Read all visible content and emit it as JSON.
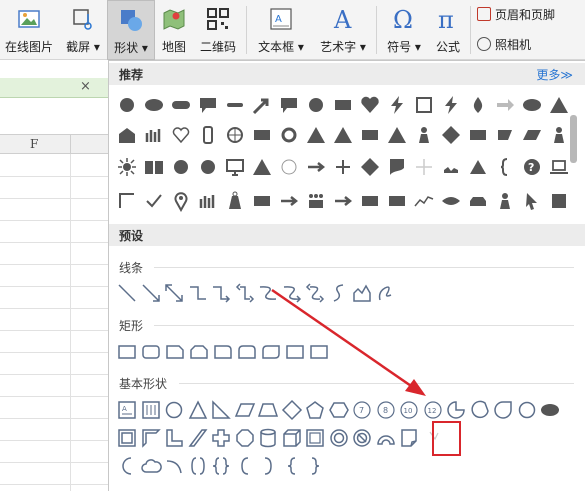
{
  "ribbon": {
    "buttons": [
      {
        "label": "在线图片"
      },
      {
        "label": "截屏 ▾"
      },
      {
        "label": "形状 ▾"
      },
      {
        "label": "地图"
      },
      {
        "label": "二维码"
      },
      {
        "label": "文本框 ▾"
      },
      {
        "label": "艺术字 ▾"
      },
      {
        "label": "符号 ▾"
      },
      {
        "label": "公式"
      }
    ],
    "header_footer": "页眉和页脚",
    "camera": "照相机"
  },
  "sheet": {
    "tab_close": "×",
    "column_f": "F"
  },
  "shapes_panel": {
    "recommended": {
      "title": "推荐",
      "more": "更多≫"
    },
    "preset": {
      "title": "预设"
    },
    "lines": {
      "title": "线条"
    },
    "rectangles": {
      "title": "矩形"
    },
    "basic_shapes": {
      "title": "基本形状"
    }
  },
  "colors": {
    "accent_red": "#d9262c",
    "shape_fill": "#555555",
    "outline_blue": "#5c6e8a",
    "more_link": "#2a76d2"
  }
}
